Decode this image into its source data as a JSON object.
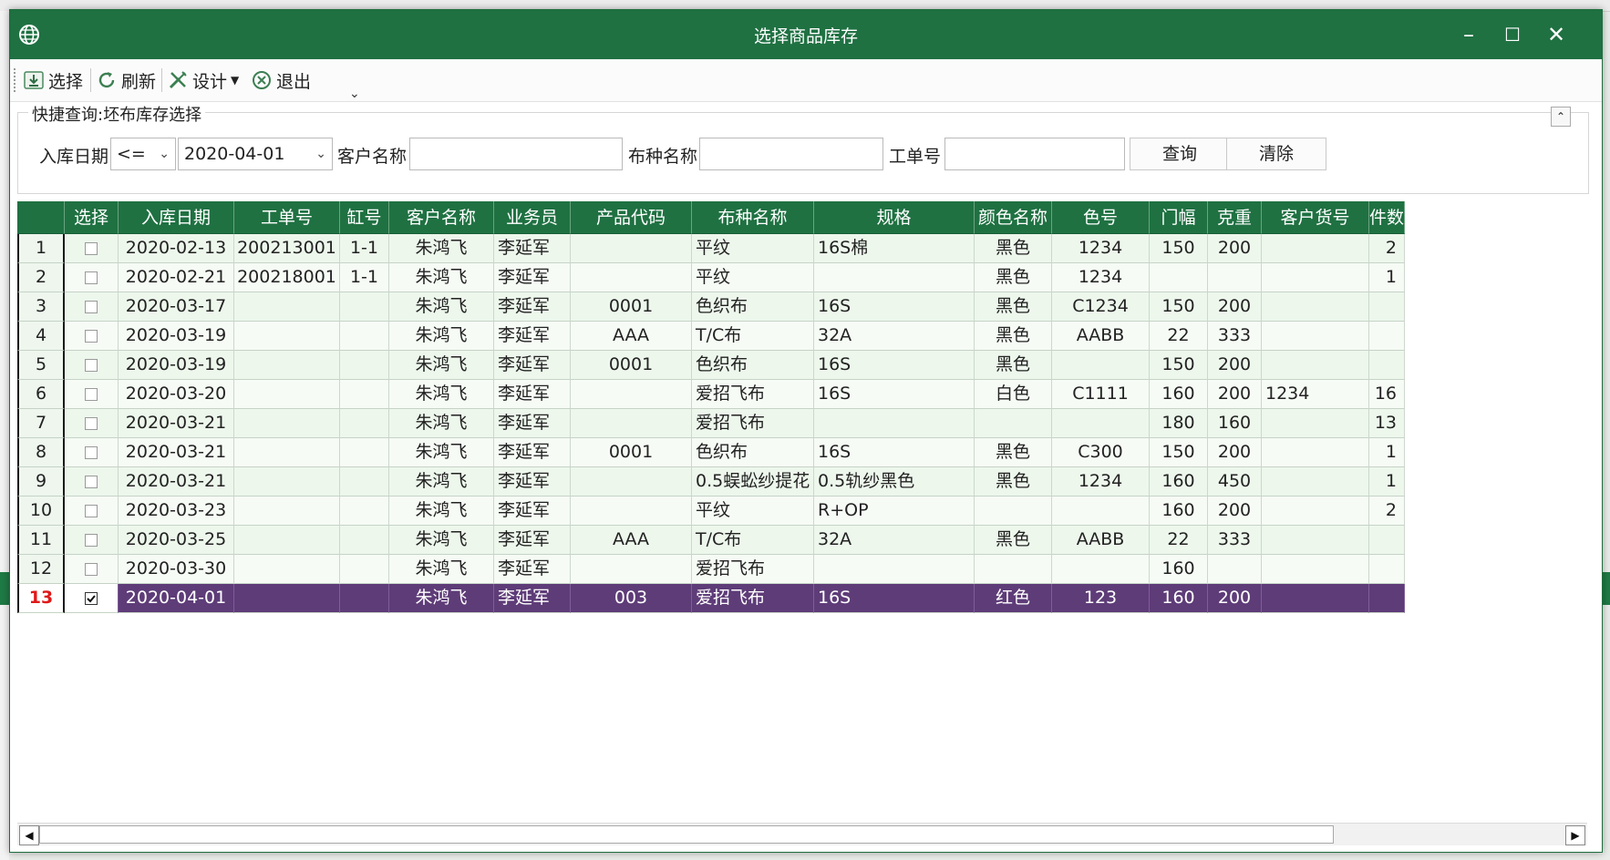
{
  "window": {
    "title": "选择商品库存",
    "controls": {
      "minimize": "–",
      "maximize": "☐",
      "close": "✕"
    }
  },
  "toolbar": {
    "select_label": "选择",
    "refresh_label": "刷新",
    "design_label": "设计",
    "exit_label": "退出",
    "more_label": "⌄"
  },
  "query": {
    "title": "快捷查询:坯布库存选择",
    "date_label": "入库日期",
    "date_op": "<=",
    "date_value": "2020-04-01",
    "customer_label": "客户名称",
    "customer_value": "",
    "fabric_label": "布种名称",
    "fabric_value": "",
    "order_label": "工单号",
    "order_value": "",
    "search_button": "查询",
    "clear_button": "清除"
  },
  "grid": {
    "columns": [
      "",
      "选择",
      "入库日期",
      "工单号",
      "缸号",
      "客户名称",
      "业务员",
      "产品代码",
      "布种名称",
      "规格",
      "颜色名称",
      "色号",
      "门幅",
      "克重",
      "客户货号",
      "件数"
    ],
    "rows": [
      {
        "num": "1",
        "checked": false,
        "date": "2020-02-13",
        "order": "200213001",
        "vat": "1-1",
        "customer": "朱鸿飞",
        "sales": "李延军",
        "code": "",
        "fabric": "平纹",
        "spec": "16S棉",
        "color": "黑色",
        "colorno": "1234",
        "width": "150",
        "weight": "200",
        "custno": "",
        "pieces": "2"
      },
      {
        "num": "2",
        "checked": false,
        "date": "2020-02-21",
        "order": "200218001",
        "vat": "1-1",
        "customer": "朱鸿飞",
        "sales": "李延军",
        "code": "",
        "fabric": "平纹",
        "spec": "",
        "color": "黑色",
        "colorno": "1234",
        "width": "",
        "weight": "",
        "custno": "",
        "pieces": "1"
      },
      {
        "num": "3",
        "checked": false,
        "date": "2020-03-17",
        "order": "",
        "vat": "",
        "customer": "朱鸿飞",
        "sales": "李延军",
        "code": "0001",
        "fabric": "色织布",
        "spec": "16S",
        "color": "黑色",
        "colorno": "C1234",
        "width": "150",
        "weight": "200",
        "custno": "",
        "pieces": ""
      },
      {
        "num": "4",
        "checked": false,
        "date": "2020-03-19",
        "order": "",
        "vat": "",
        "customer": "朱鸿飞",
        "sales": "李延军",
        "code": "AAA",
        "fabric": "T/C布",
        "spec": "32A",
        "color": "黑色",
        "colorno": "AABB",
        "width": "22",
        "weight": "333",
        "custno": "",
        "pieces": ""
      },
      {
        "num": "5",
        "checked": false,
        "date": "2020-03-19",
        "order": "",
        "vat": "",
        "customer": "朱鸿飞",
        "sales": "李延军",
        "code": "0001",
        "fabric": "色织布",
        "spec": "16S",
        "color": "黑色",
        "colorno": "",
        "width": "150",
        "weight": "200",
        "custno": "",
        "pieces": ""
      },
      {
        "num": "6",
        "checked": false,
        "date": "2020-03-20",
        "order": "",
        "vat": "",
        "customer": "朱鸿飞",
        "sales": "李延军",
        "code": "",
        "fabric": "爱招飞布",
        "spec": "16S",
        "color": "白色",
        "colorno": "C1111",
        "width": "160",
        "weight": "200",
        "custno": "1234",
        "pieces": "16"
      },
      {
        "num": "7",
        "checked": false,
        "date": "2020-03-21",
        "order": "",
        "vat": "",
        "customer": "朱鸿飞",
        "sales": "李延军",
        "code": "",
        "fabric": "爱招飞布",
        "spec": "",
        "color": "",
        "colorno": "",
        "width": "180",
        "weight": "160",
        "custno": "",
        "pieces": "13"
      },
      {
        "num": "8",
        "checked": false,
        "date": "2020-03-21",
        "order": "",
        "vat": "",
        "customer": "朱鸿飞",
        "sales": "李延军",
        "code": "0001",
        "fabric": "色织布",
        "spec": "16S",
        "color": "黑色",
        "colorno": "C300",
        "width": "150",
        "weight": "200",
        "custno": "",
        "pieces": "1"
      },
      {
        "num": "9",
        "checked": false,
        "date": "2020-03-21",
        "order": "",
        "vat": "",
        "customer": "朱鸿飞",
        "sales": "李延军",
        "code": "",
        "fabric": "0.5蜈蚣纱提花",
        "spec": "0.5轨纱黑色",
        "color": "黑色",
        "colorno": "1234",
        "width": "160",
        "weight": "450",
        "custno": "",
        "pieces": "1"
      },
      {
        "num": "10",
        "checked": false,
        "date": "2020-03-23",
        "order": "",
        "vat": "",
        "customer": "朱鸿飞",
        "sales": "李延军",
        "code": "",
        "fabric": "平纹",
        "spec": "R+OP",
        "color": "",
        "colorno": "",
        "width": "160",
        "weight": "200",
        "custno": "",
        "pieces": "2"
      },
      {
        "num": "11",
        "checked": false,
        "date": "2020-03-25",
        "order": "",
        "vat": "",
        "customer": "朱鸿飞",
        "sales": "李延军",
        "code": "AAA",
        "fabric": "T/C布",
        "spec": "32A",
        "color": "黑色",
        "colorno": "AABB",
        "width": "22",
        "weight": "333",
        "custno": "",
        "pieces": ""
      },
      {
        "num": "12",
        "checked": false,
        "date": "2020-03-30",
        "order": "",
        "vat": "",
        "customer": "朱鸿飞",
        "sales": "李延军",
        "code": "",
        "fabric": "爱招飞布",
        "spec": "",
        "color": "",
        "colorno": "",
        "width": "160",
        "weight": "",
        "custno": "",
        "pieces": ""
      },
      {
        "num": "13",
        "checked": true,
        "date": "2020-04-01",
        "order": "",
        "vat": "",
        "customer": "朱鸿飞",
        "sales": "李延军",
        "code": "003",
        "fabric": "爱招飞布",
        "spec": "16S",
        "color": "红色",
        "colorno": "123",
        "width": "160",
        "weight": "200",
        "custno": "",
        "pieces": ""
      }
    ],
    "selected_row": "13"
  },
  "colors": {
    "header_green": "#1f7142",
    "selected_row": "#5e3c78",
    "row_bg": "#edf7ec"
  }
}
